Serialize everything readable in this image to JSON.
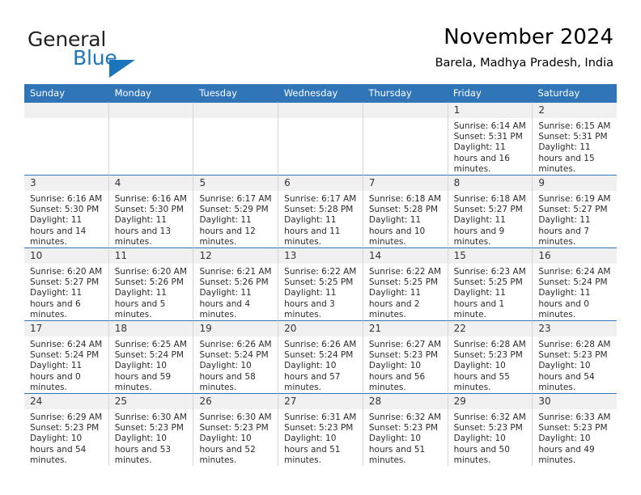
{
  "brand": {
    "name_part1": "General",
    "name_part2": "Blue",
    "accent_color": "#1b75bb"
  },
  "header": {
    "title": "November 2024",
    "location": "Barela, Madhya Pradesh, India"
  },
  "calendar": {
    "header_color": "#3075b8",
    "weekdays": [
      "Sunday",
      "Monday",
      "Tuesday",
      "Wednesday",
      "Thursday",
      "Friday",
      "Saturday"
    ],
    "weeks": [
      [
        {
          "day": "",
          "info": ""
        },
        {
          "day": "",
          "info": ""
        },
        {
          "day": "",
          "info": ""
        },
        {
          "day": "",
          "info": ""
        },
        {
          "day": "",
          "info": ""
        },
        {
          "day": "1",
          "info": "Sunrise: 6:14 AM\nSunset: 5:31 PM\nDaylight: 11 hours and 16 minutes."
        },
        {
          "day": "2",
          "info": "Sunrise: 6:15 AM\nSunset: 5:31 PM\nDaylight: 11 hours and 15 minutes."
        }
      ],
      [
        {
          "day": "3",
          "info": "Sunrise: 6:16 AM\nSunset: 5:30 PM\nDaylight: 11 hours and 14 minutes."
        },
        {
          "day": "4",
          "info": "Sunrise: 6:16 AM\nSunset: 5:30 PM\nDaylight: 11 hours and 13 minutes."
        },
        {
          "day": "5",
          "info": "Sunrise: 6:17 AM\nSunset: 5:29 PM\nDaylight: 11 hours and 12 minutes."
        },
        {
          "day": "6",
          "info": "Sunrise: 6:17 AM\nSunset: 5:28 PM\nDaylight: 11 hours and 11 minutes."
        },
        {
          "day": "7",
          "info": "Sunrise: 6:18 AM\nSunset: 5:28 PM\nDaylight: 11 hours and 10 minutes."
        },
        {
          "day": "8",
          "info": "Sunrise: 6:18 AM\nSunset: 5:27 PM\nDaylight: 11 hours and 9 minutes."
        },
        {
          "day": "9",
          "info": "Sunrise: 6:19 AM\nSunset: 5:27 PM\nDaylight: 11 hours and 7 minutes."
        }
      ],
      [
        {
          "day": "10",
          "info": "Sunrise: 6:20 AM\nSunset: 5:27 PM\nDaylight: 11 hours and 6 minutes."
        },
        {
          "day": "11",
          "info": "Sunrise: 6:20 AM\nSunset: 5:26 PM\nDaylight: 11 hours and 5 minutes."
        },
        {
          "day": "12",
          "info": "Sunrise: 6:21 AM\nSunset: 5:26 PM\nDaylight: 11 hours and 4 minutes."
        },
        {
          "day": "13",
          "info": "Sunrise: 6:22 AM\nSunset: 5:25 PM\nDaylight: 11 hours and 3 minutes."
        },
        {
          "day": "14",
          "info": "Sunrise: 6:22 AM\nSunset: 5:25 PM\nDaylight: 11 hours and 2 minutes."
        },
        {
          "day": "15",
          "info": "Sunrise: 6:23 AM\nSunset: 5:25 PM\nDaylight: 11 hours and 1 minute."
        },
        {
          "day": "16",
          "info": "Sunrise: 6:24 AM\nSunset: 5:24 PM\nDaylight: 11 hours and 0 minutes."
        }
      ],
      [
        {
          "day": "17",
          "info": "Sunrise: 6:24 AM\nSunset: 5:24 PM\nDaylight: 11 hours and 0 minutes."
        },
        {
          "day": "18",
          "info": "Sunrise: 6:25 AM\nSunset: 5:24 PM\nDaylight: 10 hours and 59 minutes."
        },
        {
          "day": "19",
          "info": "Sunrise: 6:26 AM\nSunset: 5:24 PM\nDaylight: 10 hours and 58 minutes."
        },
        {
          "day": "20",
          "info": "Sunrise: 6:26 AM\nSunset: 5:24 PM\nDaylight: 10 hours and 57 minutes."
        },
        {
          "day": "21",
          "info": "Sunrise: 6:27 AM\nSunset: 5:23 PM\nDaylight: 10 hours and 56 minutes."
        },
        {
          "day": "22",
          "info": "Sunrise: 6:28 AM\nSunset: 5:23 PM\nDaylight: 10 hours and 55 minutes."
        },
        {
          "day": "23",
          "info": "Sunrise: 6:28 AM\nSunset: 5:23 PM\nDaylight: 10 hours and 54 minutes."
        }
      ],
      [
        {
          "day": "24",
          "info": "Sunrise: 6:29 AM\nSunset: 5:23 PM\nDaylight: 10 hours and 54 minutes."
        },
        {
          "day": "25",
          "info": "Sunrise: 6:30 AM\nSunset: 5:23 PM\nDaylight: 10 hours and 53 minutes."
        },
        {
          "day": "26",
          "info": "Sunrise: 6:30 AM\nSunset: 5:23 PM\nDaylight: 10 hours and 52 minutes."
        },
        {
          "day": "27",
          "info": "Sunrise: 6:31 AM\nSunset: 5:23 PM\nDaylight: 10 hours and 51 minutes."
        },
        {
          "day": "28",
          "info": "Sunrise: 6:32 AM\nSunset: 5:23 PM\nDaylight: 10 hours and 51 minutes."
        },
        {
          "day": "29",
          "info": "Sunrise: 6:32 AM\nSunset: 5:23 PM\nDaylight: 10 hours and 50 minutes."
        },
        {
          "day": "30",
          "info": "Sunrise: 6:33 AM\nSunset: 5:23 PM\nDaylight: 10 hours and 49 minutes."
        }
      ]
    ]
  }
}
